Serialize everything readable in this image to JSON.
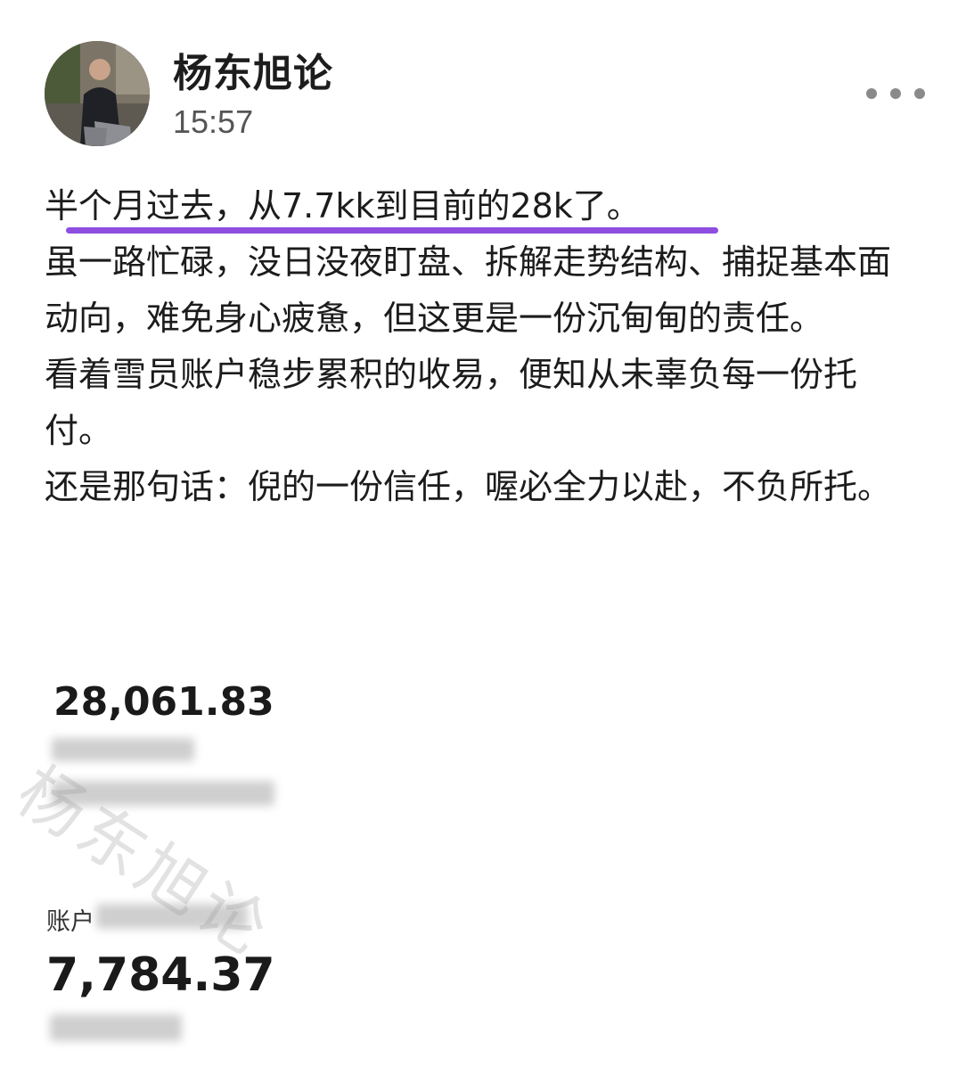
{
  "author": {
    "name": "杨东旭论",
    "time": "15:57",
    "avatar_icon": "profile-photo"
  },
  "more_icon": "more-dots-icon",
  "post": {
    "paragraphs": [
      "半个月过去，从7.7kk到目前的28k了。",
      "虽一路忙碌，没日没夜盯盘、拆解走势结构、捕捉基本面动向，难免身心疲惫，但这更是一份沉甸甸的责任。",
      "看着雪员账户稳步累积的收易，便知从未辜负每一份托付。",
      "还是那句话：倪的一份信任，喔必全力以赴，不负所托。"
    ],
    "highlight_color": "#8e4fe0"
  },
  "screenshot": {
    "amount_current": "28,061.83",
    "label_account": "账户",
    "amount_initial": "7,784.37",
    "watermark": "杨东旭论"
  }
}
